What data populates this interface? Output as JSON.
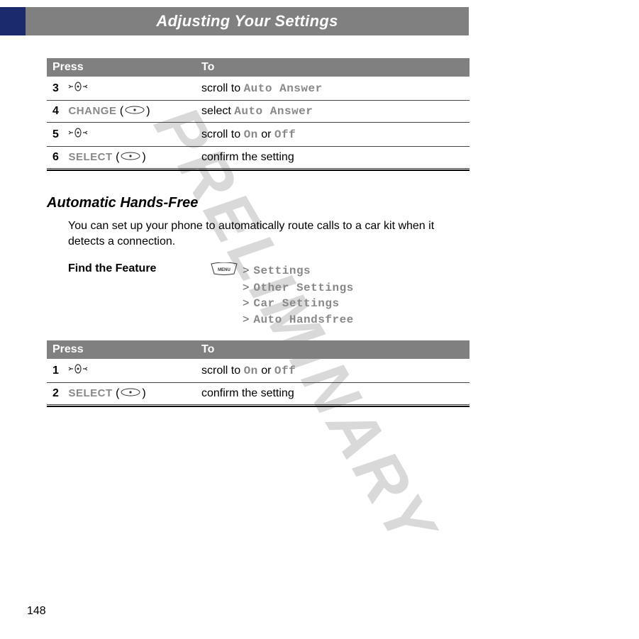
{
  "header": {
    "title": "Adjusting Your Settings"
  },
  "table1": {
    "head_press": "Press",
    "head_to": "To",
    "rows": [
      {
        "num": "3",
        "key_type": "nav",
        "key_label": "",
        "to_before": "scroll to ",
        "to_lcd": "Auto Answer",
        "to_after": ""
      },
      {
        "num": "4",
        "key_type": "soft",
        "key_label": "CHANGE",
        "to_before": "select ",
        "to_lcd": "Auto Answer",
        "to_after": ""
      },
      {
        "num": "5",
        "key_type": "nav",
        "key_label": "",
        "to_before": "scroll to ",
        "to_lcd": "On",
        "to_mid": " or ",
        "to_lcd2": "Off",
        "to_after": ""
      },
      {
        "num": "6",
        "key_type": "soft",
        "key_label": "SELECT",
        "to_before": "confirm the setting",
        "to_lcd": "",
        "to_after": ""
      }
    ]
  },
  "section": {
    "heading": "Automatic Hands-Free",
    "body": "You can set up your phone to automatically route calls to a car kit when it detects a connection.",
    "find_label": "Find the Feature",
    "menu_label": "MENU",
    "path": [
      "Settings",
      "Other Settings",
      "Car Settings",
      "Auto Handsfree"
    ],
    "gt": ">"
  },
  "table2": {
    "head_press": "Press",
    "head_to": "To",
    "rows": [
      {
        "num": "1",
        "key_type": "nav",
        "key_label": "",
        "to_before": "scroll to ",
        "to_lcd": "On",
        "to_mid": " or ",
        "to_lcd2": "Off",
        "to_after": ""
      },
      {
        "num": "2",
        "key_type": "soft",
        "key_label": "SELECT",
        "to_before": "confirm the setting",
        "to_lcd": "",
        "to_after": ""
      }
    ]
  },
  "watermark": "PRELIMINARY",
  "page_number": "148",
  "paren_open": " (",
  "paren_close": ")"
}
